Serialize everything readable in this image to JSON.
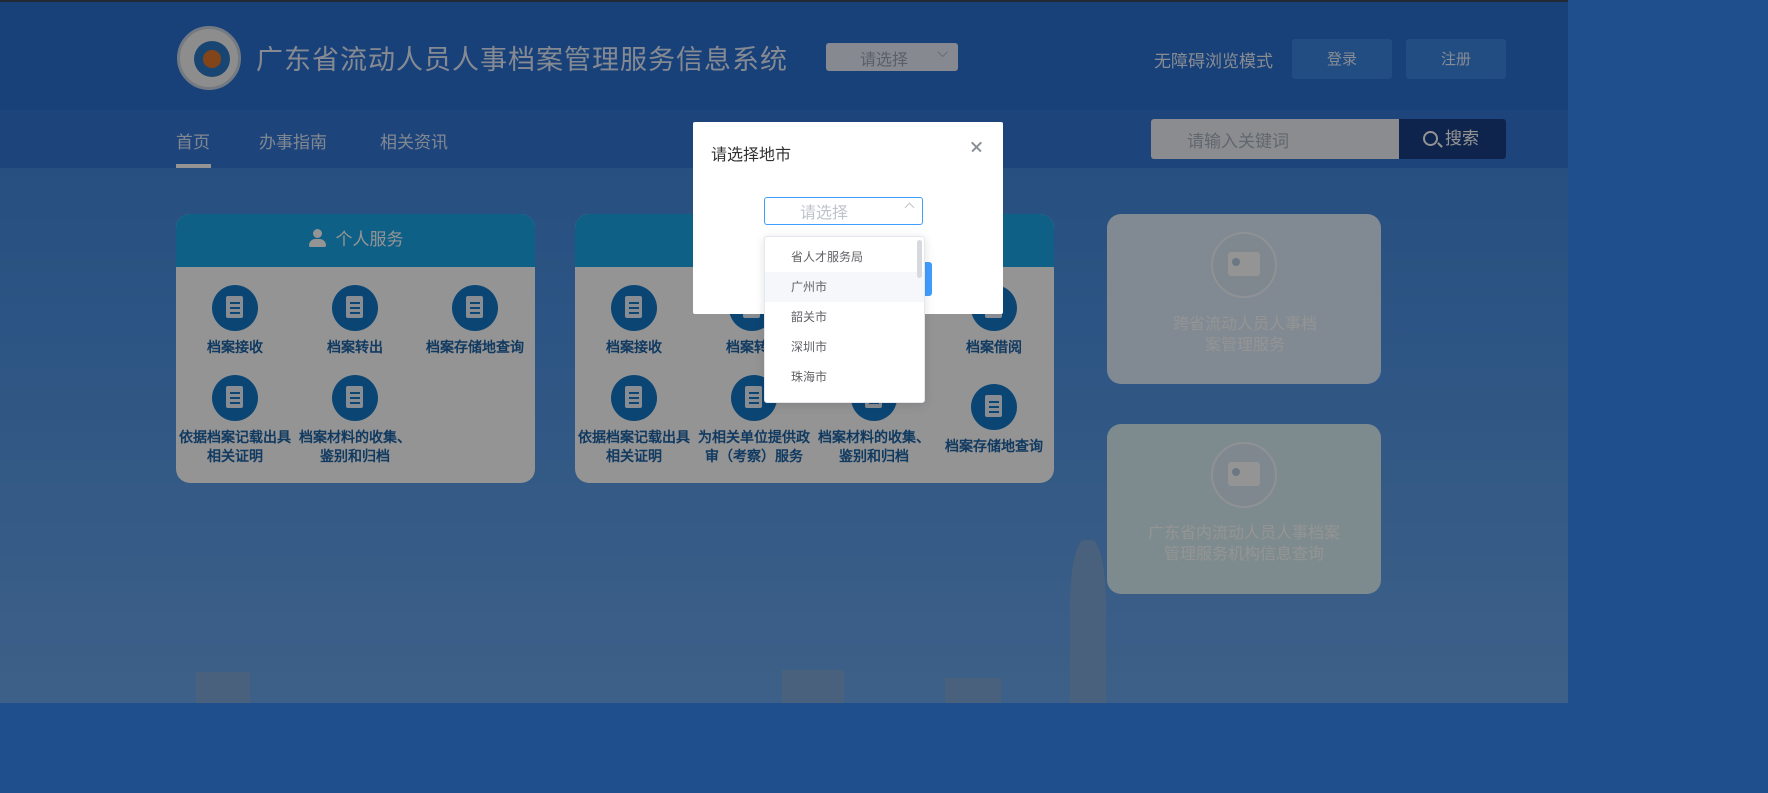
{
  "header": {
    "site_title": "广东省流动人员人事档案管理服务信息系统",
    "region_select_placeholder": "请选择",
    "accessibility_mode": "无障碍浏览模式",
    "login_label": "登录",
    "register_label": "注册"
  },
  "nav": {
    "items": [
      "首页",
      "办事指南",
      "相关资讯"
    ],
    "search_placeholder": "请输入关键词",
    "search_button": "搜索"
  },
  "personal_services": {
    "title": "个人服务",
    "items": [
      "档案接收",
      "档案转出",
      "档案存储地查询",
      "依据档案记载出具相关证明",
      "档案材料的收集、鉴别和归档"
    ]
  },
  "unit_services": {
    "items": [
      "档案接收",
      "档案转出",
      "档案借阅",
      "依据档案记载出具相关证明",
      "为相关单位提供政审（考察）服务",
      "档案材料的收集、鉴别和归档",
      "档案存储地查询"
    ]
  },
  "side_cards": {
    "cross_province": "跨省流动人员人事档案管理服务",
    "in_province": "广东省内流动人员人事档案管理服务机构信息查询"
  },
  "dialog": {
    "title": "请选择地市",
    "select_placeholder": "请选择",
    "options": [
      "省人才服务局",
      "广州市",
      "韶关市",
      "深圳市",
      "珠海市"
    ]
  }
}
